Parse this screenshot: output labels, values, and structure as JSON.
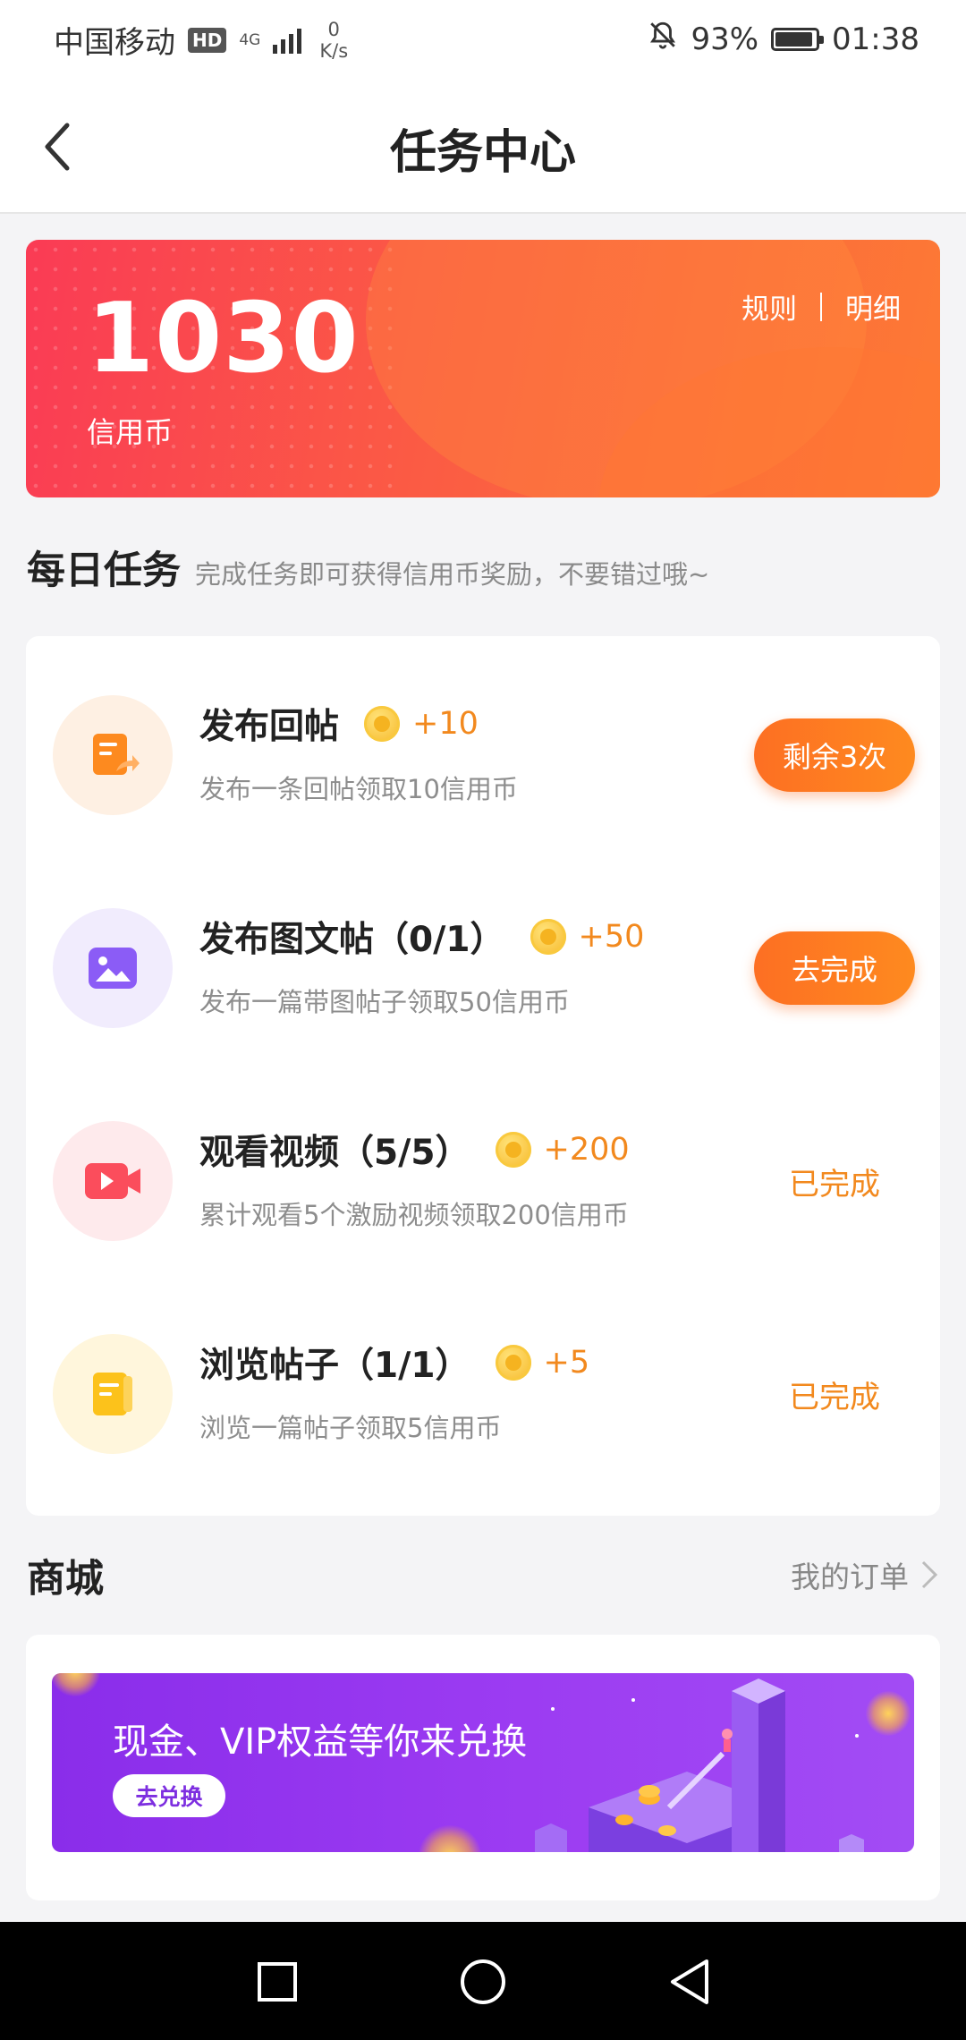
{
  "status_bar": {
    "carrier": "中国移动",
    "hd_badge": "HD",
    "network": "4G",
    "speed_value": "0",
    "speed_unit": "K/s",
    "battery_percent": "93%",
    "battery_level": 0.93,
    "time": "01:38",
    "icons": [
      "signal-icon",
      "mute-bell-icon",
      "battery-icon"
    ]
  },
  "header": {
    "title": "任务中心",
    "back_icon": "chevron-left-icon"
  },
  "credit": {
    "value": "1030",
    "label": "信用币",
    "rules_link": "规则",
    "separator": "|",
    "details_link": "明细"
  },
  "daily": {
    "title": "每日任务",
    "subtitle": "完成任务即可获得信用币奖励，不要错过哦~",
    "tasks": [
      {
        "title": "发布回帖",
        "reward": "+10",
        "desc": "发布一条回帖领取10信用币",
        "action": "剩余3次",
        "icon": "reply-post-icon",
        "color": "#fd8a1f"
      },
      {
        "title": "发布图文帖（0/1）",
        "reward": "+50",
        "desc": "发布一篇带图帖子领取50信用币",
        "action": "去完成",
        "icon": "image-post-icon",
        "color": "#8b5cf6"
      },
      {
        "title": "观看视频（5/5）",
        "reward": "+200",
        "desc": "累计观看5个激励视频领取200信用币",
        "action": "已完成",
        "icon": "video-icon",
        "color": "#fb4d5c"
      },
      {
        "title": "浏览帖子（1/1）",
        "reward": "+5",
        "desc": "浏览一篇帖子领取5信用币",
        "action": "已完成",
        "icon": "browse-post-icon",
        "color": "#fcc21b"
      }
    ]
  },
  "mall": {
    "title": "商城",
    "orders_link": "我的订单",
    "banner_text": "现金、VIP权益等你来兑换",
    "banner_button": "去兑换"
  },
  "colors": {
    "accent": "#fd7a27",
    "banner_start": "#fa3b55",
    "banner_end": "#fd7a34",
    "mall_purple": "#9c3cf2"
  }
}
